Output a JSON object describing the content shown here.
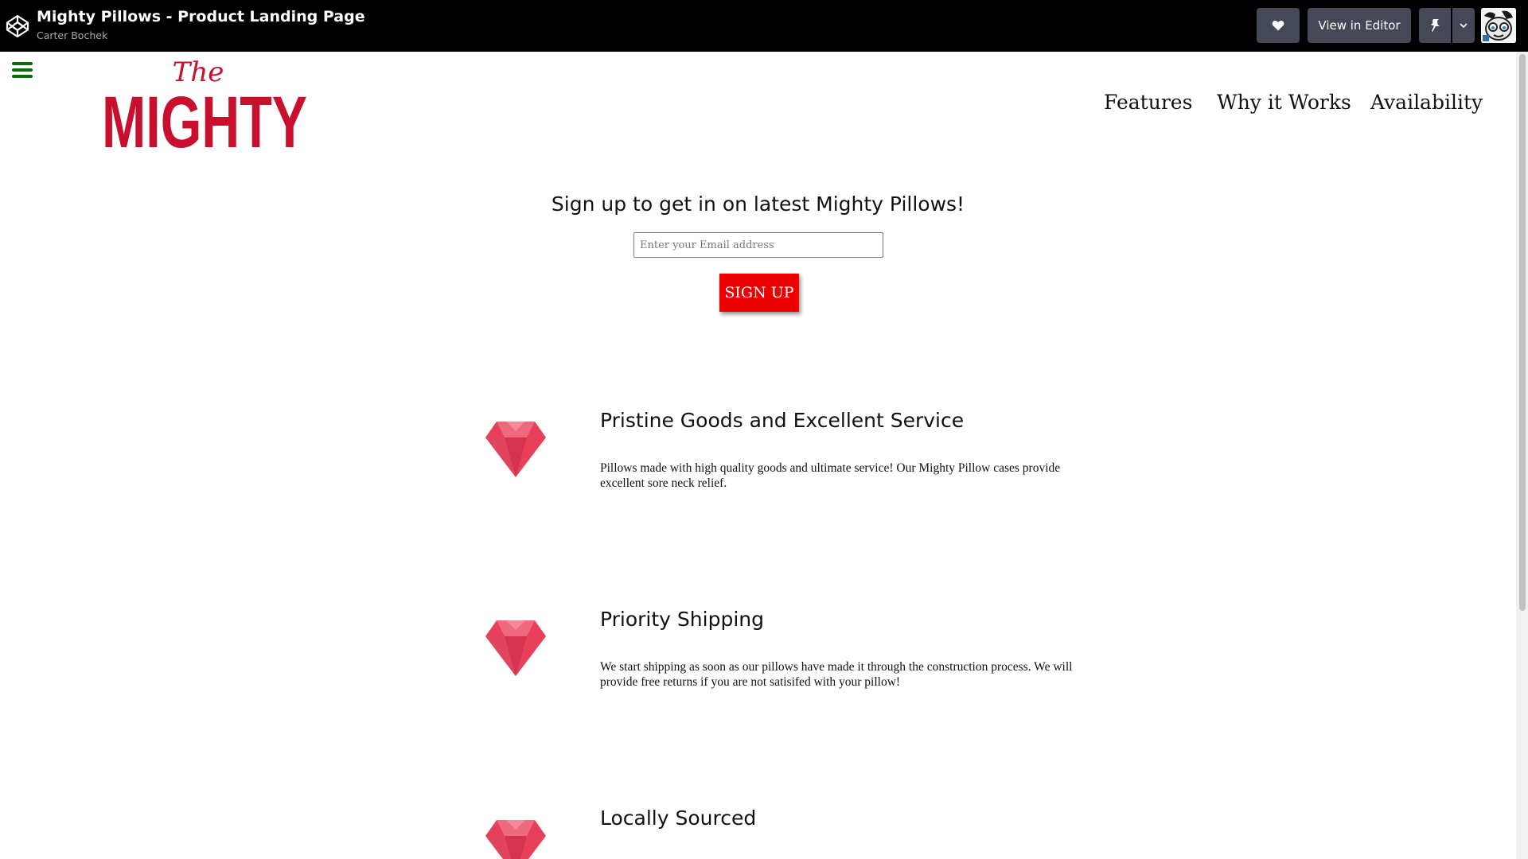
{
  "topbar": {
    "title": "Mighty Pillows - Product Landing Page",
    "author": "Carter Bochek",
    "heart_icon": "heart-icon",
    "view_in_editor": "View in Editor",
    "pin_icon": "pin-icon",
    "caret_icon": "chevron-down-icon"
  },
  "header": {
    "logo_top": "The",
    "logo_bottom": "MIGHTY",
    "logo_color": "#c8102e",
    "nav": [
      "Features",
      "Why it Works",
      "Availability"
    ]
  },
  "signup": {
    "heading": "Sign up to get in on latest Mighty Pillows!",
    "email_placeholder": "Enter your Email address",
    "button_label": "SIGN UP",
    "button_color": "#ee0000"
  },
  "features": [
    {
      "icon": "gem-icon",
      "title": "Pristine Goods and Excellent Service",
      "description": "Pillows made with high quality goods and ultimate service! Our Mighty Pillow cases provide excellent sore neck relief."
    },
    {
      "icon": "gem-icon",
      "title": "Priority Shipping",
      "description": "We start shipping as soon as our pillows have made it through the construction process. We will provide free returns if you are not satisifed with your pillow!"
    },
    {
      "icon": "gem-icon",
      "title": "Locally Sourced",
      "description": ""
    }
  ],
  "colors": {
    "hamburger": "#0a6b0a",
    "gem": "#e8405a"
  }
}
